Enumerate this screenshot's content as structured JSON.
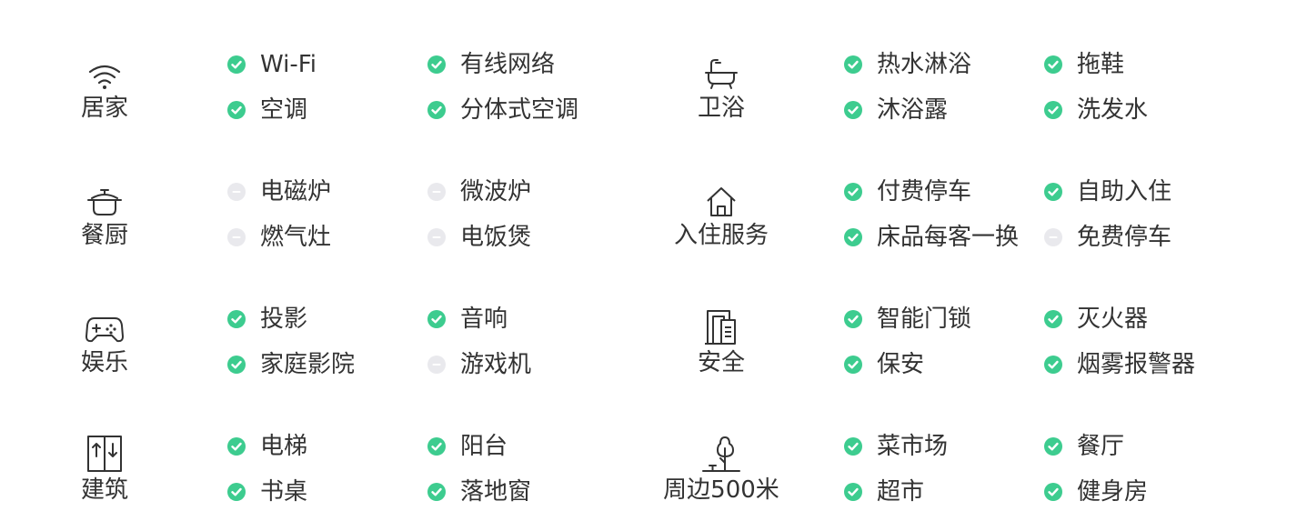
{
  "colors": {
    "check": "#3dcc8f",
    "unavailable": "#e9e9ed",
    "text": "#333333",
    "icon": "#333333"
  },
  "categories": [
    {
      "label": "居家",
      "icon": "wifi-icon",
      "items": [
        {
          "text": "Wi-Fi",
          "available": true
        },
        {
          "text": "有线网络",
          "available": true
        },
        {
          "text": "空调",
          "available": true
        },
        {
          "text": "分体式空调",
          "available": true
        }
      ]
    },
    {
      "label": "卫浴",
      "icon": "bathtub-icon",
      "items": [
        {
          "text": "热水淋浴",
          "available": true
        },
        {
          "text": "拖鞋",
          "available": true
        },
        {
          "text": "沐浴露",
          "available": true
        },
        {
          "text": "洗发水",
          "available": true
        }
      ]
    },
    {
      "label": "餐厨",
      "icon": "cooking-pot-icon",
      "items": [
        {
          "text": "电磁炉",
          "available": false
        },
        {
          "text": "微波炉",
          "available": false
        },
        {
          "text": "燃气灶",
          "available": false
        },
        {
          "text": "电饭煲",
          "available": false
        }
      ]
    },
    {
      "label": "入住服务",
      "icon": "house-icon",
      "items": [
        {
          "text": "付费停车",
          "available": true
        },
        {
          "text": "自助入住",
          "available": true
        },
        {
          "text": "床品每客一换",
          "available": true
        },
        {
          "text": "免费停车",
          "available": false
        }
      ]
    },
    {
      "label": "娱乐",
      "icon": "gamepad-icon",
      "items": [
        {
          "text": "投影",
          "available": true
        },
        {
          "text": "音响",
          "available": true
        },
        {
          "text": "家庭影院",
          "available": true
        },
        {
          "text": "游戏机",
          "available": false
        }
      ]
    },
    {
      "label": "安全",
      "icon": "door-lock-icon",
      "items": [
        {
          "text": "智能门锁",
          "available": true
        },
        {
          "text": "灭火器",
          "available": true
        },
        {
          "text": "保安",
          "available": true
        },
        {
          "text": "烟雾报警器",
          "available": true
        }
      ]
    },
    {
      "label": "建筑",
      "icon": "elevator-icon",
      "items": [
        {
          "text": "电梯",
          "available": true
        },
        {
          "text": "阳台",
          "available": true
        },
        {
          "text": "书桌",
          "available": true
        },
        {
          "text": "落地窗",
          "available": true
        }
      ]
    },
    {
      "label": "周边500米",
      "icon": "tree-icon",
      "items": [
        {
          "text": "菜市场",
          "available": true
        },
        {
          "text": "餐厅",
          "available": true
        },
        {
          "text": "超市",
          "available": true
        },
        {
          "text": "健身房",
          "available": true
        }
      ]
    }
  ]
}
